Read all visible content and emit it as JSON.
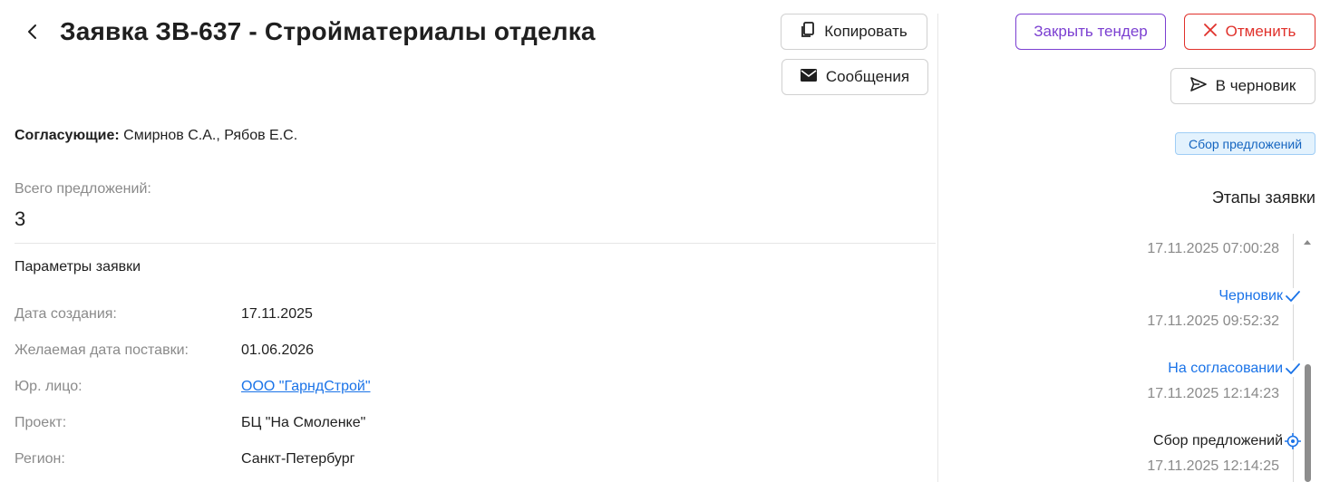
{
  "header": {
    "title": "Заявка ЗВ-637 - Стройматериалы отделка",
    "back_icon": "chevron-left-icon",
    "copy_label": "Копировать",
    "copy_icon": "copy-icon",
    "messages_label": "Сообщения",
    "messages_icon": "envelope-icon"
  },
  "approvers": {
    "label": "Согласующие:",
    "value": "Смирнов С.А., Рябов Е.С."
  },
  "offers": {
    "label": "Всего предложений:",
    "value": "3"
  },
  "params": {
    "title": "Параметры заявки",
    "rows": [
      {
        "label": "Дата создания:",
        "value": "17.11.2025"
      },
      {
        "label": "Желаемая дата поставки:",
        "value": "01.06.2026"
      },
      {
        "label": "Юр. лицо:",
        "value": "ООО \"ГарндСтрой\""
      },
      {
        "label": "Проект:",
        "value": "БЦ \"На Смоленке\""
      },
      {
        "label": "Регион:",
        "value": "Санкт-Петербург"
      }
    ]
  },
  "actions": {
    "close_tender_label": "Закрыть тендер",
    "cancel_label": "Отменить",
    "cancel_icon": "close-icon",
    "draft_label": "В черновик",
    "draft_icon": "send-icon"
  },
  "status": {
    "label": "Сбор предложений"
  },
  "stages": {
    "title": "Этапы заявки",
    "items": [
      {
        "date": "17.11.2025 07:00:28"
      },
      {
        "name": "Черновик",
        "state": "done",
        "icon": "check-icon",
        "date": "17.11.2025 09:52:32"
      },
      {
        "name": "На согласовании",
        "state": "done",
        "icon": "check-icon",
        "date": "17.11.2025 12:14:23"
      },
      {
        "name": "Сбор предложений",
        "state": "current",
        "icon": "target-icon",
        "date": "17.11.2025 12:14:25"
      }
    ]
  },
  "colors": {
    "accent_purple": "#7b3fd1",
    "danger_red": "#e0312b",
    "link_blue": "#1a73e8",
    "badge_bg": "#e3f2fd"
  }
}
